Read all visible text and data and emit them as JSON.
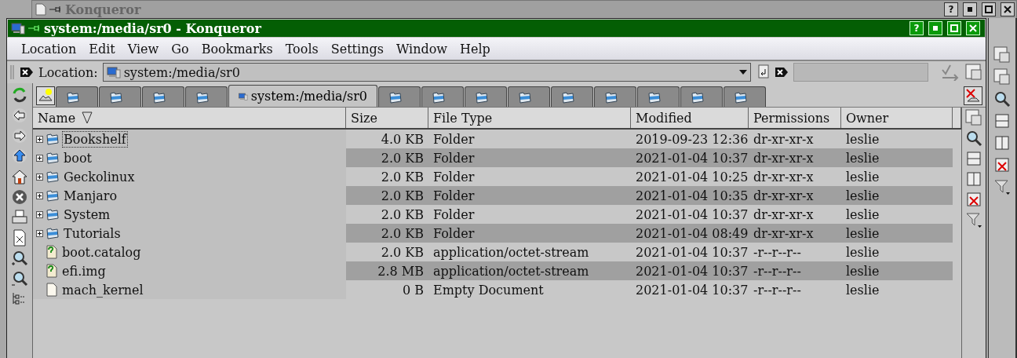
{
  "background_window": {
    "title": "Konqueror",
    "buttons": [
      "?"
    ]
  },
  "window": {
    "title": "system:/media/sr0 - Konqueror",
    "buttons": [
      "?"
    ]
  },
  "menu": [
    "Location",
    "Edit",
    "View",
    "Go",
    "Bookmarks",
    "Tools",
    "Settings",
    "Window",
    "Help"
  ],
  "location": {
    "label": "Location:",
    "value": "system:/media/sr0"
  },
  "tabs": [
    {
      "selected": false
    },
    {
      "selected": false
    },
    {
      "selected": false
    },
    {
      "selected": false
    },
    {
      "label": "system:/media/sr0",
      "selected": true
    },
    {
      "selected": false
    },
    {
      "selected": false
    },
    {
      "selected": false
    },
    {
      "selected": false
    },
    {
      "selected": false
    },
    {
      "selected": false
    },
    {
      "selected": false
    },
    {
      "selected": false
    },
    {
      "selected": false
    }
  ],
  "table": {
    "columns": [
      "Name",
      "Size",
      "File Type",
      "Modified",
      "Permissions",
      "Owner"
    ],
    "rows": [
      {
        "kind": "folder",
        "expanded": false,
        "selected": true,
        "cells": [
          "Bookshelf",
          "4.0 KB",
          "Folder",
          "2019-09-23 12:36",
          "dr-xr-xr-x",
          "leslie"
        ]
      },
      {
        "kind": "folder",
        "expanded": false,
        "selected": false,
        "cells": [
          "boot",
          "2.0 KB",
          "Folder",
          "2021-01-04 10:37",
          "dr-xr-xr-x",
          "leslie"
        ]
      },
      {
        "kind": "folder",
        "expanded": false,
        "selected": false,
        "cells": [
          "Geckolinux",
          "2.0 KB",
          "Folder",
          "2021-01-04 10:25",
          "dr-xr-xr-x",
          "leslie"
        ]
      },
      {
        "kind": "folder",
        "expanded": false,
        "selected": false,
        "cells": [
          "Manjaro",
          "2.0 KB",
          "Folder",
          "2021-01-04 10:35",
          "dr-xr-xr-x",
          "leslie"
        ]
      },
      {
        "kind": "folder",
        "expanded": false,
        "selected": false,
        "cells": [
          "System",
          "2.0 KB",
          "Folder",
          "2021-01-04 10:37",
          "dr-xr-xr-x",
          "leslie"
        ]
      },
      {
        "kind": "folder",
        "expanded": false,
        "selected": false,
        "cells": [
          "Tutorials",
          "2.0 KB",
          "Folder",
          "2021-01-04 08:49",
          "dr-xr-xr-x",
          "leslie"
        ]
      },
      {
        "kind": "unknown",
        "selected": false,
        "cells": [
          "boot.catalog",
          "2.0 KB",
          "application/octet-stream",
          "2021-01-04 10:37",
          "-r--r--r--",
          "leslie"
        ]
      },
      {
        "kind": "unknown",
        "selected": false,
        "cells": [
          "efi.img",
          "2.8 MB",
          "application/octet-stream",
          "2021-01-04 10:37",
          "-r--r--r--",
          "leslie"
        ]
      },
      {
        "kind": "empty",
        "selected": false,
        "cells": [
          "mach_kernel",
          "0 B",
          "Empty Document",
          "2021-01-04 10:37",
          "-r--r--r--",
          "leslie"
        ]
      }
    ]
  }
}
